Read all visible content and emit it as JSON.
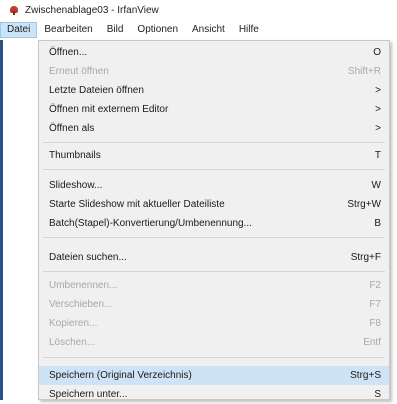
{
  "window": {
    "title": "Zwischenablage03 - IrfanView"
  },
  "menubar": [
    "Datei",
    "Bearbeiten",
    "Bild",
    "Optionen",
    "Ansicht",
    "Hilfe"
  ],
  "menu": {
    "items": [
      {
        "label": "Öffnen...",
        "shortcut": "O",
        "disabled": false
      },
      {
        "label": "Erneut öffnen",
        "shortcut": "Shift+R",
        "disabled": true
      },
      {
        "label": "Letzte Dateien öffnen",
        "shortcut": ">",
        "disabled": false
      },
      {
        "label": "Öffnen mit externem Editor",
        "shortcut": ">",
        "disabled": false
      },
      {
        "label": "Öffnen als",
        "shortcut": ">",
        "disabled": false
      },
      {
        "label": "Thumbnails",
        "shortcut": "T",
        "disabled": false
      },
      {
        "label": "Slideshow...",
        "shortcut": "W",
        "disabled": false
      },
      {
        "label": "Starte Slideshow mit aktueller Dateiliste",
        "shortcut": "Strg+W",
        "disabled": false
      },
      {
        "label": "Batch(Stapel)-Konvertierung/Umbenennung...",
        "shortcut": "B",
        "disabled": false
      },
      {
        "label": "Dateien suchen...",
        "shortcut": "Strg+F",
        "disabled": false
      },
      {
        "label": "Umbenennen...",
        "shortcut": "F2",
        "disabled": true
      },
      {
        "label": "Verschieben...",
        "shortcut": "F7",
        "disabled": true
      },
      {
        "label": "Kopieren...",
        "shortcut": "F8",
        "disabled": true
      },
      {
        "label": "Löschen...",
        "shortcut": "Entf",
        "disabled": true
      },
      {
        "label": "Speichern (Original Verzeichnis)",
        "shortcut": "Strg+S",
        "disabled": false,
        "highlighted": true
      },
      {
        "label": "Speichern unter...",
        "shortcut": "S",
        "disabled": false
      }
    ]
  }
}
